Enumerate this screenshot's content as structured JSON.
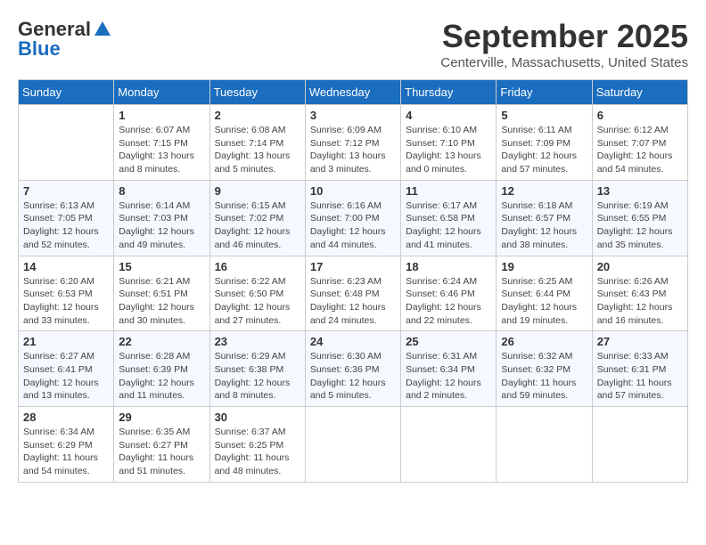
{
  "logo": {
    "general": "General",
    "blue": "Blue"
  },
  "header": {
    "month": "September 2025",
    "location": "Centerville, Massachusetts, United States"
  },
  "weekdays": [
    "Sunday",
    "Monday",
    "Tuesday",
    "Wednesday",
    "Thursday",
    "Friday",
    "Saturday"
  ],
  "weeks": [
    [
      {
        "day": "",
        "info": ""
      },
      {
        "day": "1",
        "info": "Sunrise: 6:07 AM\nSunset: 7:15 PM\nDaylight: 13 hours\nand 8 minutes."
      },
      {
        "day": "2",
        "info": "Sunrise: 6:08 AM\nSunset: 7:14 PM\nDaylight: 13 hours\nand 5 minutes."
      },
      {
        "day": "3",
        "info": "Sunrise: 6:09 AM\nSunset: 7:12 PM\nDaylight: 13 hours\nand 3 minutes."
      },
      {
        "day": "4",
        "info": "Sunrise: 6:10 AM\nSunset: 7:10 PM\nDaylight: 13 hours\nand 0 minutes."
      },
      {
        "day": "5",
        "info": "Sunrise: 6:11 AM\nSunset: 7:09 PM\nDaylight: 12 hours\nand 57 minutes."
      },
      {
        "day": "6",
        "info": "Sunrise: 6:12 AM\nSunset: 7:07 PM\nDaylight: 12 hours\nand 54 minutes."
      }
    ],
    [
      {
        "day": "7",
        "info": "Sunrise: 6:13 AM\nSunset: 7:05 PM\nDaylight: 12 hours\nand 52 minutes."
      },
      {
        "day": "8",
        "info": "Sunrise: 6:14 AM\nSunset: 7:03 PM\nDaylight: 12 hours\nand 49 minutes."
      },
      {
        "day": "9",
        "info": "Sunrise: 6:15 AM\nSunset: 7:02 PM\nDaylight: 12 hours\nand 46 minutes."
      },
      {
        "day": "10",
        "info": "Sunrise: 6:16 AM\nSunset: 7:00 PM\nDaylight: 12 hours\nand 44 minutes."
      },
      {
        "day": "11",
        "info": "Sunrise: 6:17 AM\nSunset: 6:58 PM\nDaylight: 12 hours\nand 41 minutes."
      },
      {
        "day": "12",
        "info": "Sunrise: 6:18 AM\nSunset: 6:57 PM\nDaylight: 12 hours\nand 38 minutes."
      },
      {
        "day": "13",
        "info": "Sunrise: 6:19 AM\nSunset: 6:55 PM\nDaylight: 12 hours\nand 35 minutes."
      }
    ],
    [
      {
        "day": "14",
        "info": "Sunrise: 6:20 AM\nSunset: 6:53 PM\nDaylight: 12 hours\nand 33 minutes."
      },
      {
        "day": "15",
        "info": "Sunrise: 6:21 AM\nSunset: 6:51 PM\nDaylight: 12 hours\nand 30 minutes."
      },
      {
        "day": "16",
        "info": "Sunrise: 6:22 AM\nSunset: 6:50 PM\nDaylight: 12 hours\nand 27 minutes."
      },
      {
        "day": "17",
        "info": "Sunrise: 6:23 AM\nSunset: 6:48 PM\nDaylight: 12 hours\nand 24 minutes."
      },
      {
        "day": "18",
        "info": "Sunrise: 6:24 AM\nSunset: 6:46 PM\nDaylight: 12 hours\nand 22 minutes."
      },
      {
        "day": "19",
        "info": "Sunrise: 6:25 AM\nSunset: 6:44 PM\nDaylight: 12 hours\nand 19 minutes."
      },
      {
        "day": "20",
        "info": "Sunrise: 6:26 AM\nSunset: 6:43 PM\nDaylight: 12 hours\nand 16 minutes."
      }
    ],
    [
      {
        "day": "21",
        "info": "Sunrise: 6:27 AM\nSunset: 6:41 PM\nDaylight: 12 hours\nand 13 minutes."
      },
      {
        "day": "22",
        "info": "Sunrise: 6:28 AM\nSunset: 6:39 PM\nDaylight: 12 hours\nand 11 minutes."
      },
      {
        "day": "23",
        "info": "Sunrise: 6:29 AM\nSunset: 6:38 PM\nDaylight: 12 hours\nand 8 minutes."
      },
      {
        "day": "24",
        "info": "Sunrise: 6:30 AM\nSunset: 6:36 PM\nDaylight: 12 hours\nand 5 minutes."
      },
      {
        "day": "25",
        "info": "Sunrise: 6:31 AM\nSunset: 6:34 PM\nDaylight: 12 hours\nand 2 minutes."
      },
      {
        "day": "26",
        "info": "Sunrise: 6:32 AM\nSunset: 6:32 PM\nDaylight: 11 hours\nand 59 minutes."
      },
      {
        "day": "27",
        "info": "Sunrise: 6:33 AM\nSunset: 6:31 PM\nDaylight: 11 hours\nand 57 minutes."
      }
    ],
    [
      {
        "day": "28",
        "info": "Sunrise: 6:34 AM\nSunset: 6:29 PM\nDaylight: 11 hours\nand 54 minutes."
      },
      {
        "day": "29",
        "info": "Sunrise: 6:35 AM\nSunset: 6:27 PM\nDaylight: 11 hours\nand 51 minutes."
      },
      {
        "day": "30",
        "info": "Sunrise: 6:37 AM\nSunset: 6:25 PM\nDaylight: 11 hours\nand 48 minutes."
      },
      {
        "day": "",
        "info": ""
      },
      {
        "day": "",
        "info": ""
      },
      {
        "day": "",
        "info": ""
      },
      {
        "day": "",
        "info": ""
      }
    ]
  ]
}
